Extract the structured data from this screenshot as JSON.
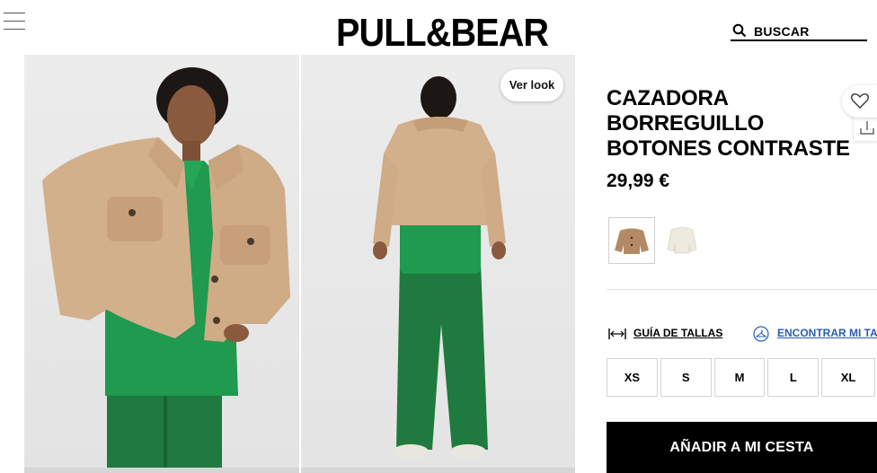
{
  "header": {
    "logo_text": "PULL&BEAR",
    "search_label": "BUSCAR",
    "icons": [
      "menu-icon",
      "search-icon"
    ]
  },
  "gallery": {
    "look_button_label": "Ver look",
    "photos": [
      "front-view",
      "back-view"
    ]
  },
  "product": {
    "title_lines": [
      "CAZADORA",
      "BORREGUILLO",
      "BOTONES CONTRASTE"
    ],
    "price": "29,99 €",
    "colors": [
      {
        "name": "camel",
        "hex": "#b48a66",
        "selected": true
      },
      {
        "name": "white",
        "hex": "#eeeadf",
        "selected": false
      }
    ],
    "size_guide_label": "GUÍA DE TALLAS",
    "find_size_label": "ENCONTRAR MI TALLA",
    "sizes": [
      "XS",
      "S",
      "M",
      "L",
      "XL"
    ],
    "add_to_cart_label": "AÑADIR A MI CESTA"
  },
  "colors": {
    "jacket": "#d2b08c",
    "shirt": "#1f9a4f",
    "pants": "#1e7a3e",
    "link_blue": "#2a5db0",
    "button_bg": "#000000"
  }
}
